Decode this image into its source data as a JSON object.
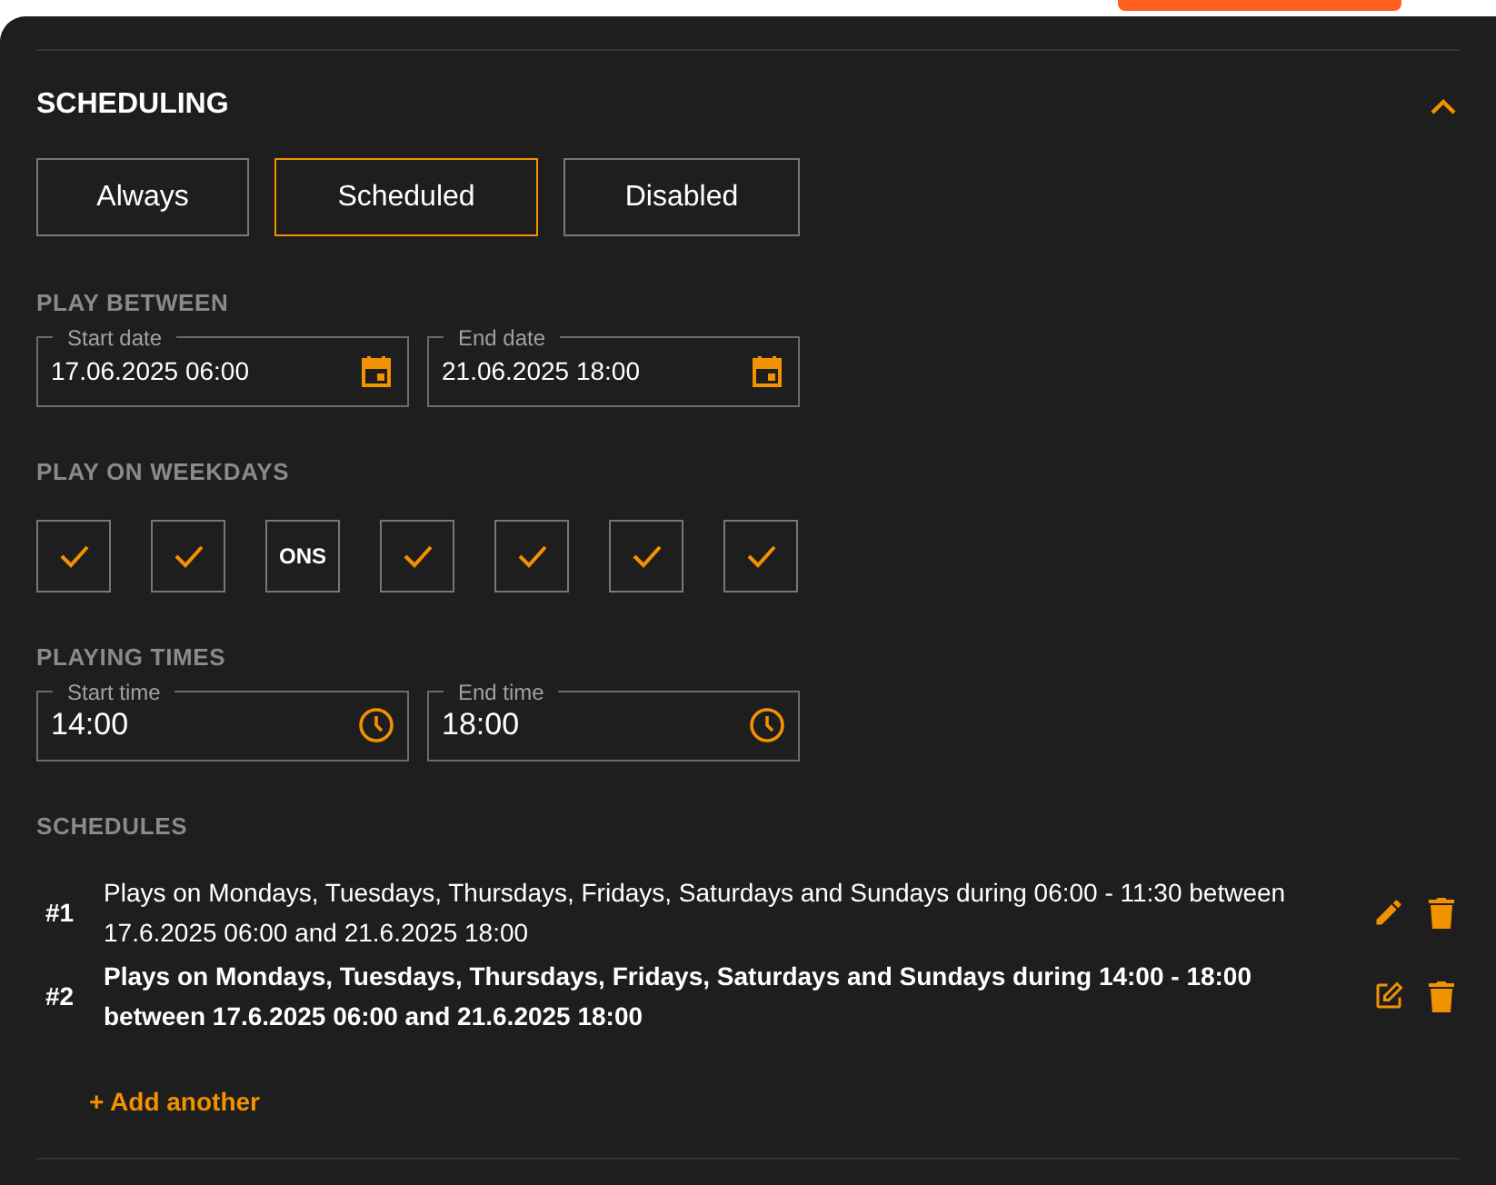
{
  "section": {
    "title": "SCHEDULING",
    "expanded": true
  },
  "modes": [
    {
      "label": "Always",
      "selected": false
    },
    {
      "label": "Scheduled",
      "selected": true
    },
    {
      "label": "Disabled",
      "selected": false
    }
  ],
  "play_between": {
    "heading": "PLAY BETWEEN",
    "fields": [
      {
        "label": "Start date",
        "value": "17.06.2025 06:00"
      },
      {
        "label": "End date",
        "value": "21.06.2025 18:00"
      }
    ]
  },
  "weekdays": {
    "heading": "PLAY ON WEEKDAYS",
    "days": [
      {
        "checked": true
      },
      {
        "checked": true
      },
      {
        "checked": false,
        "label": "ONS"
      },
      {
        "checked": true
      },
      {
        "checked": true
      },
      {
        "checked": true
      },
      {
        "checked": true
      }
    ]
  },
  "playing_times": {
    "heading": "PLAYING TIMES",
    "fields": [
      {
        "label": "Start time",
        "value": "14:00"
      },
      {
        "label": "End time",
        "value": "18:00"
      }
    ]
  },
  "schedules": {
    "heading": "SCHEDULES",
    "items": [
      {
        "number": "#1",
        "text": "Plays on Mondays, Tuesdays, Thursdays, Fridays, Saturdays and Sundays during 06:00 - 11:30 between 17.6.2025 06:00 and 21.6.2025 18:00",
        "selected": false
      },
      {
        "number": "#2",
        "text": "Plays on Mondays, Tuesdays, Thursdays, Fridays, Saturdays and Sundays during 14:00 - 18:00 between 17.6.2025 06:00 and 21.6.2025 18:00",
        "selected": true
      }
    ],
    "add_label": "+ Add another"
  }
}
